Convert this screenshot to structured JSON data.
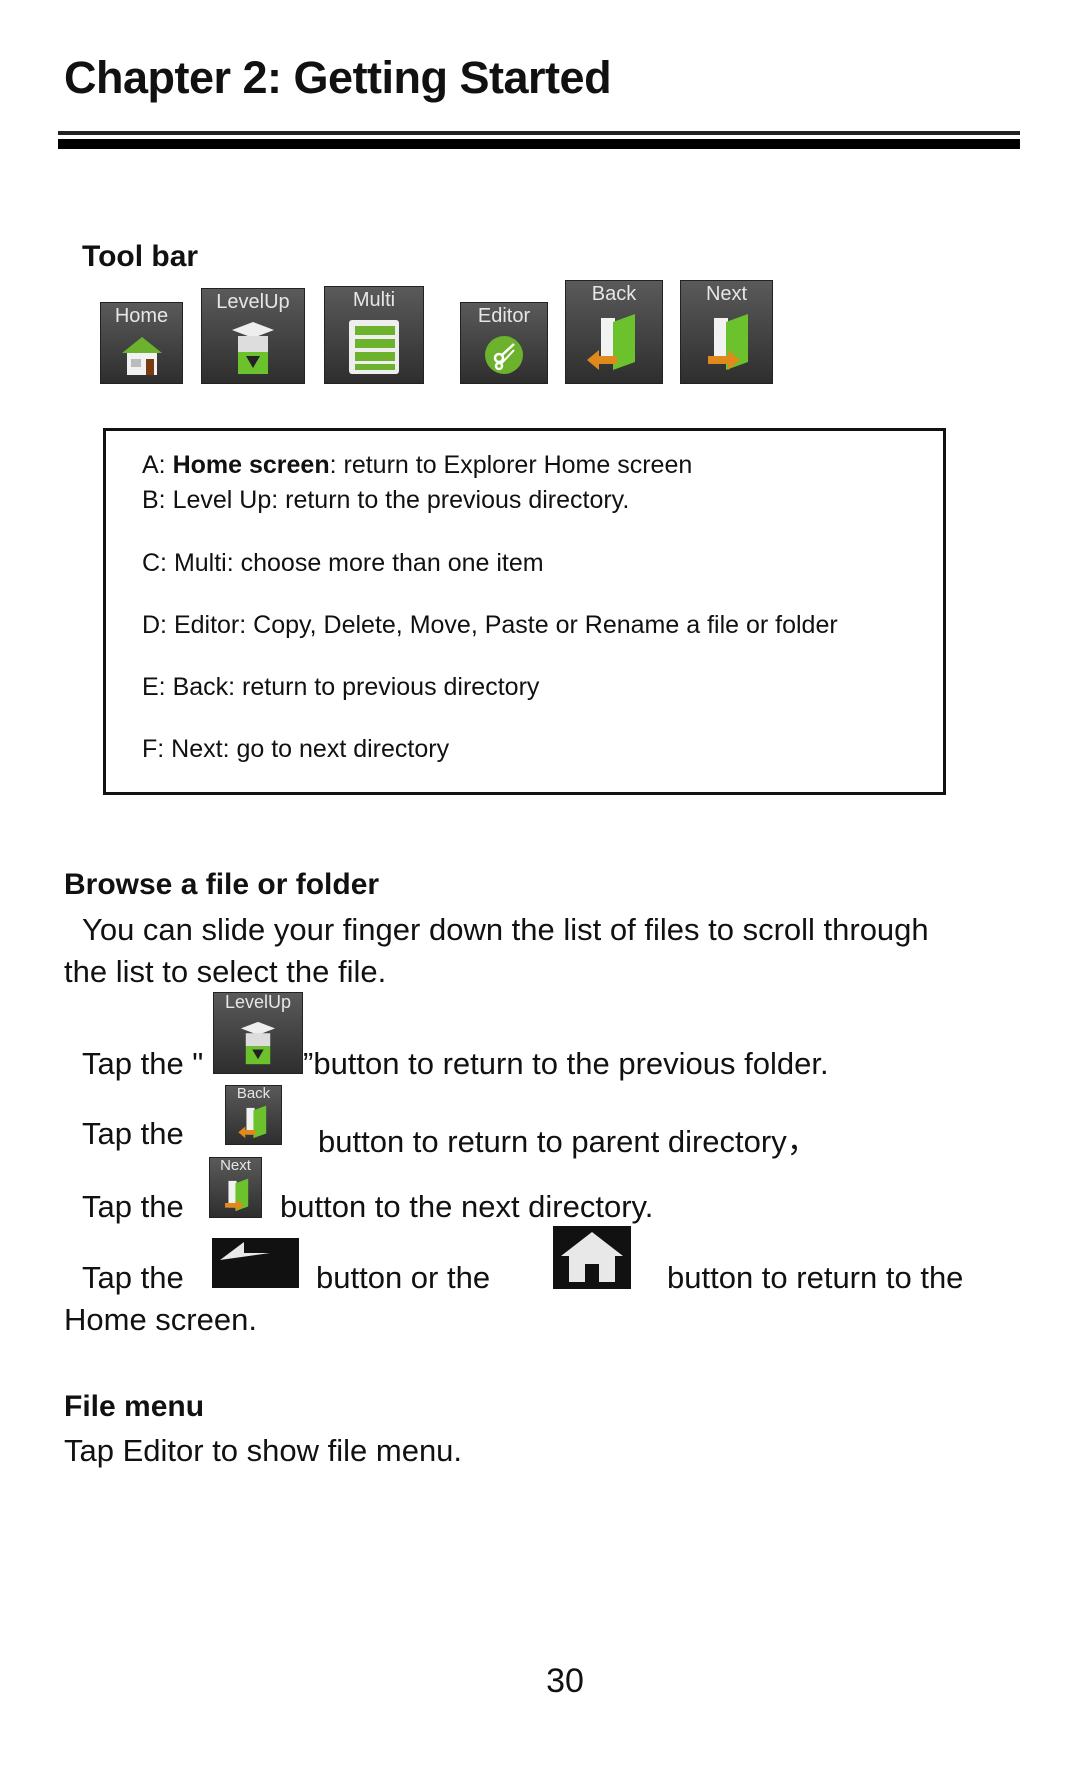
{
  "header": {
    "title": "Chapter 2: Getting Started"
  },
  "toolbar_section": {
    "heading": "Tool bar",
    "buttons": [
      {
        "label": "Home",
        "icon": "home-house-icon"
      },
      {
        "label": "LevelUp",
        "icon": "levelup-box-icon"
      },
      {
        "label": "Multi",
        "icon": "multi-list-icon"
      },
      {
        "label": "Editor",
        "icon": "editor-scissors-icon"
      },
      {
        "label": "Back",
        "icon": "back-folder-arrow-icon"
      },
      {
        "label": "Next",
        "icon": "next-folder-arrow-icon"
      }
    ],
    "legend": {
      "a_prefix": "A: ",
      "a_bold": "Home screen",
      "a_rest": ": return to Explorer Home screen",
      "b": "B:  Level Up: return to the previous directory.",
      "c": "C:  Multi: choose more than one item",
      "d": "D:  Editor: Copy, Delete, Move, Paste or Rename a file or folder",
      "e": "E:  Back: return to previous directory",
      "f": "F:  Next: go to next directory"
    }
  },
  "browse_section": {
    "heading": "Browse a file or folder",
    "intro_line1": "You can slide your finger down the list of files to scroll through",
    "intro_line2": "the list to select the file.",
    "tap_levelup_before": "Tap the \"",
    "tap_levelup_after": "”button to return to the previous folder.",
    "tap_back_before": "Tap the",
    "tap_back_after": "button to return to parent directory，",
    "tap_next_before": "Tap the",
    "tap_next_after": "button to the next directory.",
    "tap_home_before": "Tap the",
    "tap_home_middle": "button or the",
    "tap_home_after": "button to return to the",
    "tap_home_line2": "Home screen.",
    "inline_icons": {
      "levelup": "LevelUp",
      "back": "Back",
      "next": "Next"
    }
  },
  "file_menu_section": {
    "heading": "File menu",
    "text": "Tap Editor to show file menu."
  },
  "footer": {
    "page_number": "30"
  }
}
